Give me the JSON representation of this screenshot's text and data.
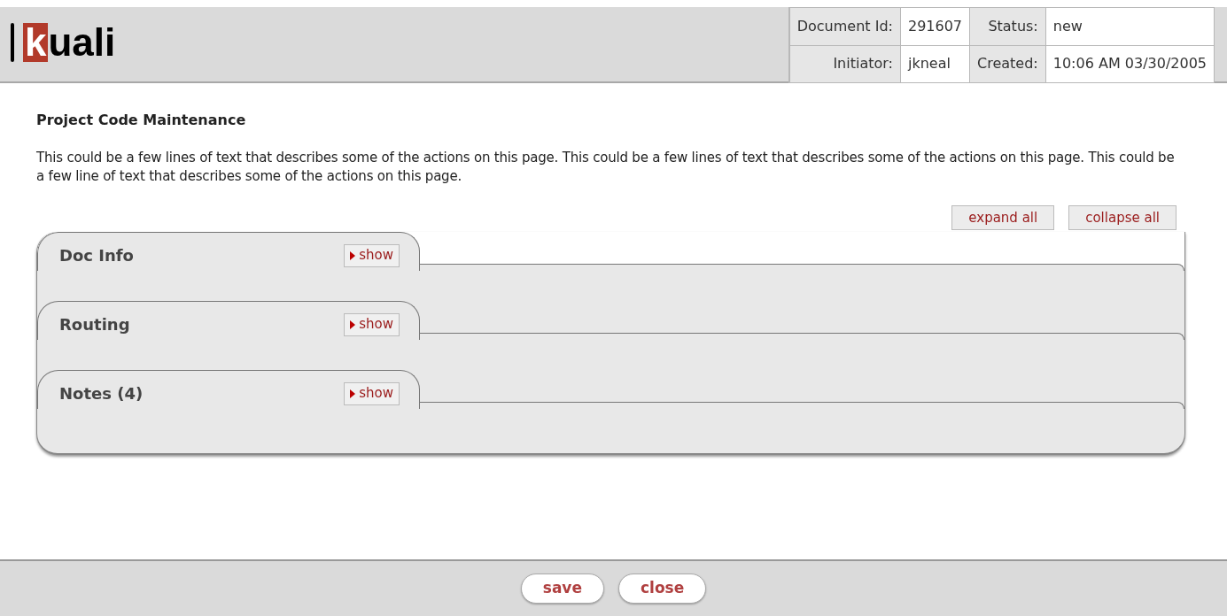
{
  "header": {
    "logo": "kuali",
    "fields": [
      {
        "label": "Document Id:",
        "value": "291607"
      },
      {
        "label": "Status:",
        "value": "new"
      },
      {
        "label": "Initiator:",
        "value": "jkneal"
      },
      {
        "label": "Created:",
        "value": "10:06 AM 03/30/2005"
      }
    ]
  },
  "page": {
    "title": "Project Code Maintenance",
    "description": "This could be a few lines of text that describes some of the actions on this page. This could be a few lines of text that describes some of the actions on this page. This could be a few line of text that describes some of the actions on this page."
  },
  "toolbar": [
    "expand all",
    "collapse all"
  ],
  "sections": [
    {
      "title": "Doc Info",
      "toggle": "show",
      "expanded": false
    },
    {
      "title": "Routing",
      "toggle": "show",
      "expanded": false
    },
    {
      "title": "Notes (4)",
      "toggle": "show",
      "expanded": false
    }
  ],
  "footer_buttons": [
    "save",
    "close"
  ]
}
